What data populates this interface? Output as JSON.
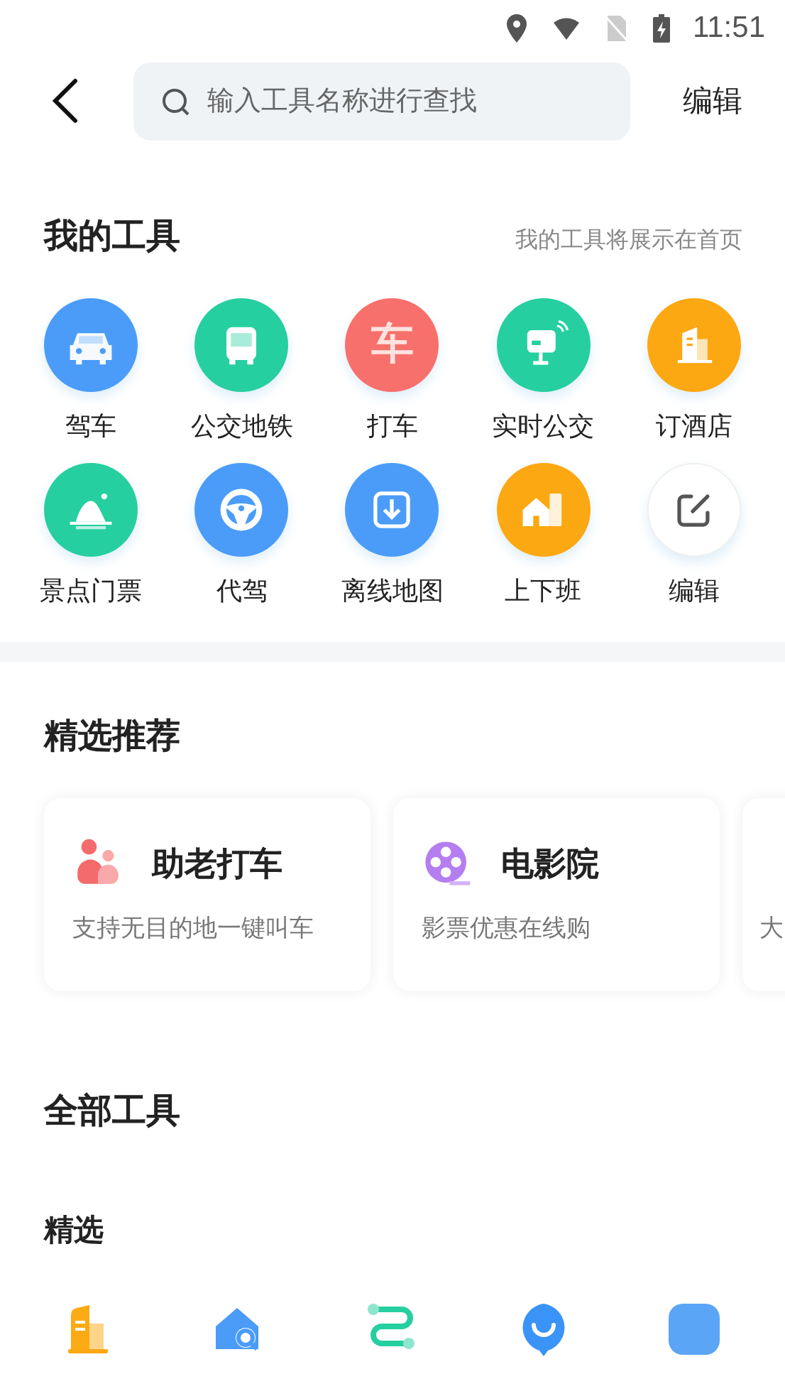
{
  "status_bar": {
    "time": "11:51"
  },
  "header": {
    "search": {
      "placeholder": "输入工具名称进行查找"
    },
    "action": "编辑"
  },
  "my_tools": {
    "title": "我的工具",
    "hint": "我的工具将展示在首页",
    "items": [
      {
        "kind": "car",
        "label": "驾车",
        "color": "#4a9cf8"
      },
      {
        "kind": "bus",
        "label": "公交地铁",
        "color": "#26cfa0"
      },
      {
        "kind": "taxi",
        "label": "打车",
        "glyph": "车",
        "color": "#f8706c"
      },
      {
        "kind": "screen",
        "label": "实时公交",
        "color": "#26cfa0"
      },
      {
        "kind": "building",
        "label": "订酒店",
        "color": "#fca812"
      },
      {
        "kind": "mountain",
        "label": "景点门票",
        "color": "#26cfa0"
      },
      {
        "kind": "wheel",
        "label": "代驾",
        "color": "#4a9cf8"
      },
      {
        "kind": "download",
        "label": "离线地图",
        "color": "#4a9cf8"
      },
      {
        "kind": "house",
        "label": "上下班",
        "color": "#fca812"
      },
      {
        "kind": "edit",
        "label": "编辑"
      }
    ]
  },
  "recommended": {
    "title": "精选推荐",
    "cards": [
      {
        "kind": "people",
        "title": "助老打车",
        "subtitle": "支持无目的地一键叫车"
      },
      {
        "kind": "film",
        "title": "电影院",
        "subtitle": "影票优惠在线购"
      },
      {
        "kind": "cut",
        "subtitle": "大"
      }
    ]
  },
  "all_tools": {
    "title": "全部工具",
    "group": "精选",
    "items": [
      {
        "kind": "building"
      },
      {
        "kind": "house-search"
      },
      {
        "kind": "route"
      },
      {
        "kind": "chat"
      },
      {
        "kind": "square"
      }
    ]
  }
}
